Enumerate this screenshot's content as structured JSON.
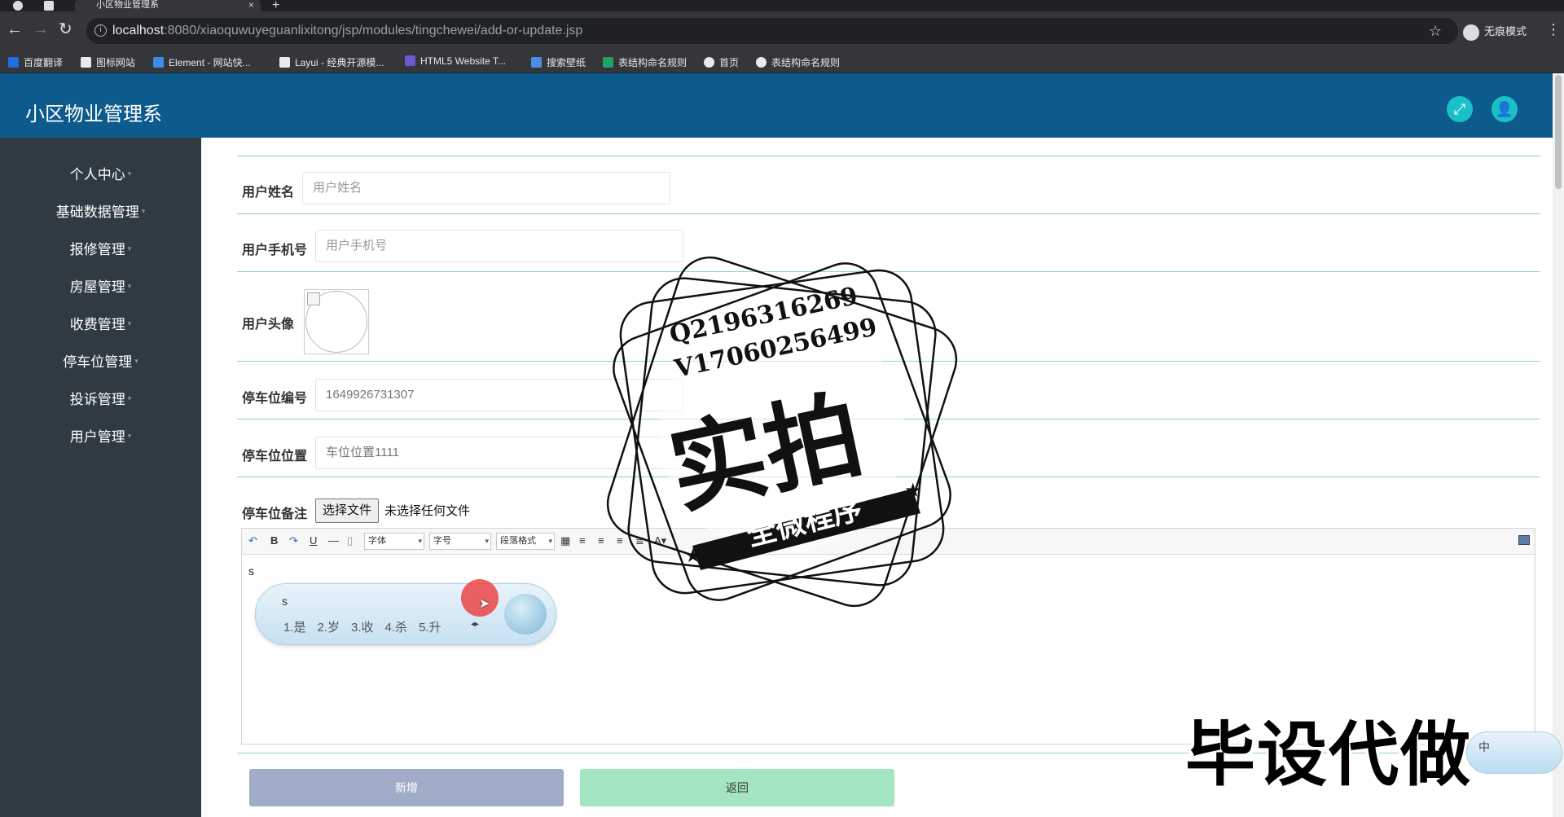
{
  "browser": {
    "tab_title": "小区物业管理系",
    "tab_close": "×",
    "new_tab": "+",
    "url_host": "localhost",
    "url_path": ":8080/xiaoquwuyeguanlixitong/jsp/modules/tingchewei/add-or-update.jsp",
    "incognito_label": "无痕模式",
    "bookmarks": [
      {
        "label": "百度翻译",
        "color": "#1e6fe0"
      },
      {
        "label": "图标网站",
        "color": "#e8eaed"
      },
      {
        "label": "Element - 网站快...",
        "color": "#3a8ee6"
      },
      {
        "label": "Layui - 经典开源模...",
        "color": "#e8eaed"
      },
      {
        "label": "HTML5 Website T...",
        "color": "#6a5acd"
      },
      {
        "label": "搜索壁纸",
        "color": "#4a90e2"
      },
      {
        "label": "表结构命名规则",
        "color": "#21a366"
      },
      {
        "label": "首页",
        "color": "#e8eaed"
      },
      {
        "label": "表结构命名规则",
        "color": "#e8eaed"
      }
    ]
  },
  "app": {
    "title": "小区物业管理系",
    "accent": "#0d5a8c",
    "button_color": "#19c0c7"
  },
  "sidebar": {
    "items": [
      {
        "label": "个人中心"
      },
      {
        "label": "基础数据管理"
      },
      {
        "label": "报修管理"
      },
      {
        "label": "房屋管理"
      },
      {
        "label": "收费管理"
      },
      {
        "label": "停车位管理"
      },
      {
        "label": "投诉管理"
      },
      {
        "label": "用户管理"
      }
    ]
  },
  "form": {
    "user_name": {
      "label": "用户姓名",
      "placeholder": "用户姓名",
      "value": ""
    },
    "user_phone": {
      "label": "用户手机号",
      "placeholder": "用户手机号",
      "value": ""
    },
    "user_avatar": {
      "label": "用户头像"
    },
    "space_number": {
      "label": "停车位编号",
      "value": "1649926731307"
    },
    "space_location": {
      "label": "停车位位置",
      "value": "车位位置1111"
    },
    "space_note": {
      "label": "停车位备注",
      "file_button": "选择文件",
      "file_status": "未选择任何文件",
      "editor": {
        "font_select": "字体",
        "size_select": "字号",
        "para_select": "段落格式",
        "content": "s"
      }
    },
    "add_button": "新增",
    "back_button": "返回"
  },
  "ime": {
    "typed": "s",
    "candidates": [
      "1.是",
      "2.岁",
      "3.收",
      "4.杀",
      "5.升"
    ],
    "mini_label": "中"
  },
  "overlay": {
    "stamp_line1": "Q2196316269",
    "stamp_line2": "V1706025649​9",
    "stamp_big": "实拍",
    "stamp_banner": "全微程序",
    "watermark": "毕设代做"
  }
}
